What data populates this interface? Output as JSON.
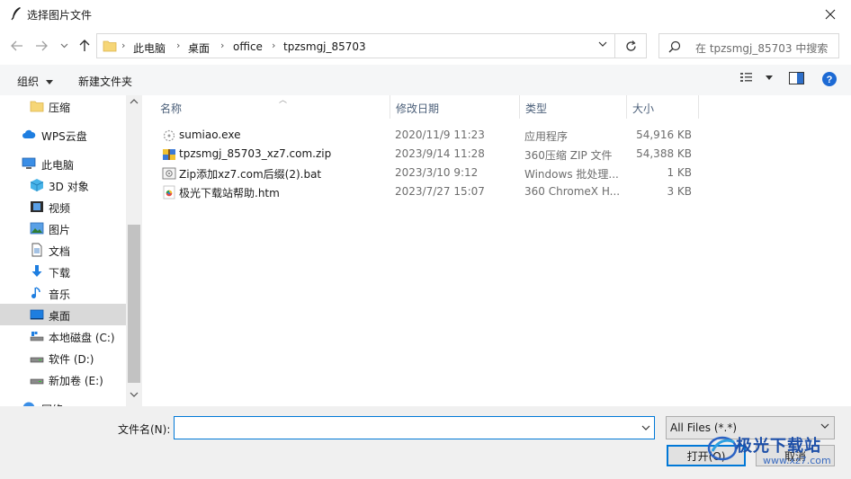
{
  "window": {
    "title": "选择图片文件"
  },
  "address": {
    "crumbs": [
      "此电脑",
      "桌面",
      "office",
      "tpzsmgj_85703"
    ]
  },
  "search": {
    "placeholder": "在 tpzsmgj_85703 中搜索"
  },
  "toolbar": {
    "organize": "组织",
    "new_folder": "新建文件夹"
  },
  "sidebar": {
    "items": [
      {
        "label": "压缩",
        "icon": "folder-icon"
      },
      {
        "label": "WPS云盘",
        "icon": "cloud-icon"
      },
      {
        "label": "此电脑",
        "icon": "computer-icon"
      },
      {
        "label": "3D 对象",
        "icon": "3d-objects-icon"
      },
      {
        "label": "视频",
        "icon": "video-icon"
      },
      {
        "label": "图片",
        "icon": "pictures-icon"
      },
      {
        "label": "文档",
        "icon": "documents-icon"
      },
      {
        "label": "下载",
        "icon": "download-icon"
      },
      {
        "label": "音乐",
        "icon": "music-icon"
      },
      {
        "label": "桌面",
        "icon": "desktop-icon",
        "selected": true
      },
      {
        "label": "本地磁盘 (C:)",
        "icon": "drive-c-icon"
      },
      {
        "label": "软件 (D:)",
        "icon": "drive-icon"
      },
      {
        "label": "新加卷 (E:)",
        "icon": "drive-icon"
      },
      {
        "label": "网络",
        "icon": "network-icon"
      }
    ]
  },
  "columns": {
    "name": "名称",
    "date": "修改日期",
    "type": "类型",
    "size": "大小"
  },
  "files": [
    {
      "name": "sumiao.exe",
      "date": "2020/11/9 11:23",
      "type": "应用程序",
      "size": "54,916 KB",
      "icon": "exe-icon"
    },
    {
      "name": "tpzsmgj_85703_xz7.com.zip",
      "date": "2023/9/14 11:28",
      "type": "360压缩 ZIP 文件",
      "size": "54,388 KB",
      "icon": "zip-icon"
    },
    {
      "name": "Zip添加xz7.com后缀(2).bat",
      "date": "2023/3/10 9:12",
      "type": "Windows 批处理...",
      "size": "1 KB",
      "icon": "bat-icon"
    },
    {
      "name": "极光下载站帮助.htm",
      "date": "2023/7/27 15:07",
      "type": "360 ChromeX H...",
      "size": "3 KB",
      "icon": "htm-icon"
    }
  ],
  "bottom": {
    "filename_label": "文件名(N):",
    "filename_value": "",
    "filetype": "All Files (*.*)",
    "open": "打开(O)",
    "cancel": "取消"
  },
  "watermark": {
    "text": "极光下载站",
    "url": "www.xz7.com"
  }
}
